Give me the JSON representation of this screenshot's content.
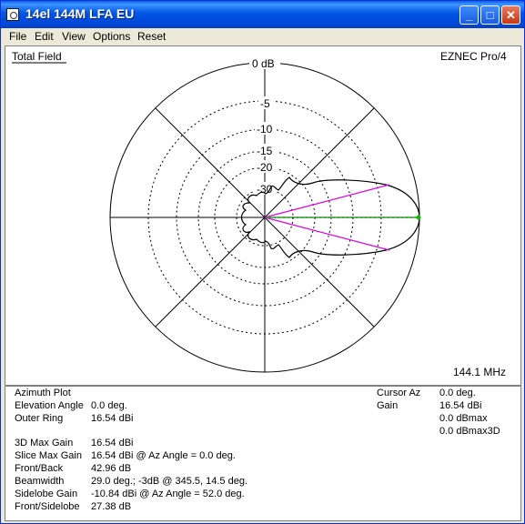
{
  "window": {
    "title": "14el 144M LFA EU",
    "minimize_glyph": "_",
    "maximize_glyph": "□",
    "close_glyph": "✕"
  },
  "menu": [
    "File",
    "Edit",
    "View",
    "Options",
    "Reset"
  ],
  "plot": {
    "title": "Total Field",
    "program": "EZNEC Pro/4",
    "frequency": "144.1 MHz",
    "ring_labels": [
      "0 dB",
      "-5",
      "-10",
      "-15",
      "-20",
      "-30"
    ]
  },
  "info": {
    "left": {
      "plot_type": "Azimuth Plot",
      "rows": [
        {
          "label": "Elevation Angle",
          "value": "0.0 deg."
        },
        {
          "label": "Outer Ring",
          "value": "16.54 dBi"
        },
        {
          "label": "3D Max Gain",
          "value": "16.54 dBi"
        },
        {
          "label": "Slice Max Gain",
          "value": "16.54 dBi @ Az Angle = 0.0 deg."
        },
        {
          "label": "Front/Back",
          "value": "42.96 dB"
        },
        {
          "label": "Beamwidth",
          "value": "29.0 deg.; -3dB @ 345.5, 14.5 deg."
        },
        {
          "label": "Sidelobe Gain",
          "value": "-10.84 dBi @ Az Angle = 52.0 deg."
        },
        {
          "label": "Front/Sidelobe",
          "value": "27.38 dB"
        }
      ]
    },
    "right": {
      "cursor_az_label": "Cursor Az",
      "cursor_az_value": "0.0 deg.",
      "gain_label": "Gain",
      "gain_value": "16.54 dBi",
      "dbmax": "0.0 dBmax",
      "dbmax3d": "0.0 dBmax3D"
    }
  },
  "colors": {
    "pattern": "#000000",
    "beamwidth_lines": "#E000E0",
    "cursor_line": "#00C000",
    "grid": "#000000"
  }
}
